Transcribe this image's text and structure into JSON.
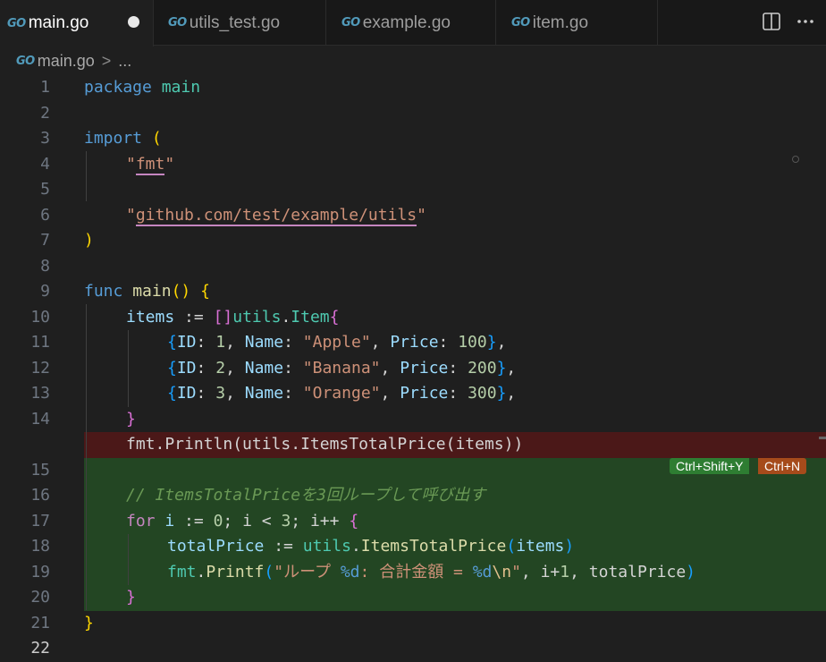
{
  "tabs": [
    {
      "label": "main.go",
      "icon": "go-icon",
      "active": true,
      "dirty": true
    },
    {
      "label": "utils_test.go",
      "icon": "go-icon"
    },
    {
      "label": "example.go",
      "icon": "go-icon"
    },
    {
      "label": "item.go",
      "icon": "go-icon"
    }
  ],
  "go_glyph": "GO",
  "toolbar": {
    "split_icon": "split-editor-icon",
    "more_icon": "more-actions-icon"
  },
  "breadcrumb": {
    "file": "main.go",
    "separator": ">",
    "tail": "..."
  },
  "line_numbers": [
    "1",
    "2",
    "3",
    "4",
    "5",
    "6",
    "7",
    "8",
    "9",
    "10",
    "11",
    "12",
    "13",
    "14",
    "15",
    "16",
    "17",
    "18",
    "19",
    "20",
    "21",
    "22"
  ],
  "code": {
    "l1a": "package",
    "l1b": "main",
    "l3a": "import",
    "l3b": "(",
    "l4a": "\"",
    "l4b": "fmt",
    "l4c": "\"",
    "l6a": "\"",
    "l6b": "github.com/test/example/utils",
    "l6c": "\"",
    "l7": ")",
    "l9a": "func",
    "l9b": "main",
    "l9c": "()",
    "l9d": "{",
    "l10a": "items",
    "l10b": ":=",
    "l10c": "[]",
    "l10d": "utils",
    "l10e": ".",
    "l10f": "Item",
    "l10g": "{",
    "rows": [
      {
        "open": "{",
        "idk": "ID",
        "idv": "1",
        "namek": "Name",
        "namev": "\"Apple\"",
        "pricek": "Price",
        "pricev": "100",
        "close": "}"
      },
      {
        "open": "{",
        "idk": "ID",
        "idv": "2",
        "namek": "Name",
        "namev": "\"Banana\"",
        "pricek": "Price",
        "pricev": "200",
        "close": "}"
      },
      {
        "open": "{",
        "idk": "ID",
        "idv": "3",
        "namek": "Name",
        "namev": "\"Orange\"",
        "pricek": "Price",
        "pricev": "300",
        "close": "}"
      }
    ],
    "l14": "}",
    "removed_line": "fmt.Println(utils.ItemsTotalPrice(items))",
    "l16": "// ItemsTotalPriceを3回ループして呼び出す",
    "l17a": "for",
    "l17b": "i",
    "l17c": ":=",
    "l17d": "0",
    "l17e": "; i < ",
    "l17f": "3",
    "l17g": "; i++ ",
    "l17h": "{",
    "l18a": "totalPrice",
    "l18b": ":=",
    "l18c": "utils",
    "l18d": ".",
    "l18e": "ItemsTotalPrice",
    "l18f": "(",
    "l18g": "items",
    "l18h": ")",
    "l19a": "fmt",
    "l19b": ".",
    "l19c": "Printf",
    "l19d": "(",
    "l19e": "\"ループ ",
    "l19f": "%d",
    "l19g": ": 合計金額 = ",
    "l19h": "%d",
    "l19i": "\\n",
    "l19j": "\"",
    "l19k": ", i+",
    "l19l": "1",
    "l19m": ", totalPrice",
    "l19n": ")",
    "l20": "}",
    "l21": "}"
  },
  "diff_actions": {
    "accept": "Ctrl+Shift+Y",
    "reject": "Ctrl+N"
  },
  "colors": {
    "removed_bg": "#4b1818",
    "added_bg": "#234623",
    "editor_bg": "#1f1f1f",
    "go_icon": "#519aba"
  }
}
